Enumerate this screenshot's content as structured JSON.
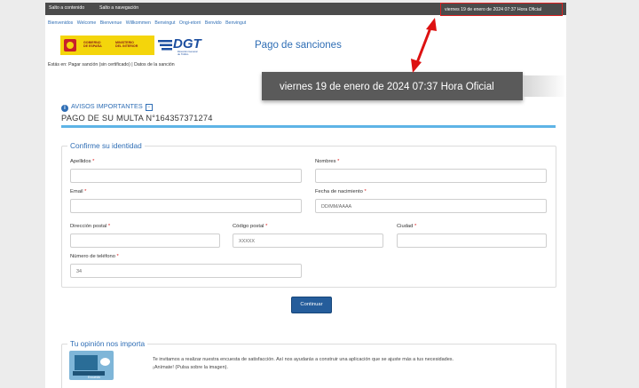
{
  "topbar": {
    "skip_content": "Salto a contenido",
    "skip_nav": "Salto a navegación",
    "datetime": "viernes 19 de enero de 2024 07:37 Hora Oficial"
  },
  "languages": [
    "Bienvenidos",
    "Welcome",
    "Bienvenue",
    "Willkommen",
    "Benvingut",
    "Ongi-etorri",
    "Benvido",
    "Benvingut"
  ],
  "logos": {
    "gobierno_line1": "GOBIERNO\nDE ESPAÑA",
    "gobierno_line2": "MINISTERIO\nDEL INTERIOR",
    "dgt": "DGT",
    "dgt_sub": "Dirección General\nde Tráfico"
  },
  "header": {
    "title": "Pago de sanciones"
  },
  "breadcrumb": "Estás en:  Pagar sanción (sin certificado) | Datos de la sanción",
  "zoom_datetime": "viernes 19 de enero de 2024 07:37 Hora Oficial",
  "notices": {
    "label": "AVISOS IMPORTANTES",
    "info_glyph": "i",
    "collapse_glyph": "−"
  },
  "fine_title": "PAGO DE SU MULTA N°164357371274",
  "identity": {
    "legend": "Confirme su identidad",
    "required_mark": "*",
    "apellidos": {
      "label": "Apellidos",
      "value": ""
    },
    "nombres": {
      "label": "Nombres",
      "value": ""
    },
    "email": {
      "label": "Email",
      "value": ""
    },
    "fecha": {
      "label": "Fecha de nacimiento",
      "placeholder": "DD/MM/AAAA"
    },
    "direccion": {
      "label": "Dirección postal",
      "value": ""
    },
    "codigo": {
      "label": "Código postal",
      "placeholder": "XXXXX"
    },
    "ciudad": {
      "label": "Ciudad",
      "value": ""
    },
    "telefono": {
      "label": "Número de teléfono",
      "value": "34"
    }
  },
  "continue_label": "Continuar",
  "opinion": {
    "legend": "Tu opinión nos importa",
    "text": "Te invitamos a realizar nuestra encuesta de satisfacción. Así nos ayudarás a construir una aplicación que se ajuste más a tus necesidades.\n¡Anímate! (Pulsa sobre la imagen).",
    "image_label": "Encuesta"
  },
  "colors": {
    "accent": "#2f6eb5",
    "topbar": "#4b4b4b",
    "button": "#255d9b",
    "highlight": "#d22222",
    "rule": "#5eb4e6"
  }
}
